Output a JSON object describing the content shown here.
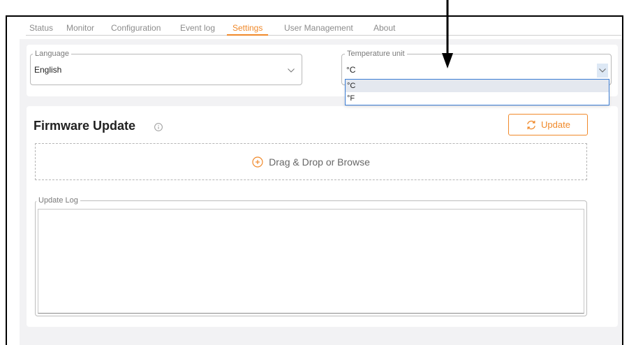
{
  "tabs": [
    {
      "label": "Status",
      "active": false
    },
    {
      "label": "Monitor",
      "active": false
    },
    {
      "label": "Configuration",
      "active": false
    },
    {
      "label": "Event log",
      "active": false
    },
    {
      "label": "Settings",
      "active": true
    },
    {
      "label": "User Management",
      "active": false
    },
    {
      "label": "About",
      "active": false
    }
  ],
  "settings": {
    "language": {
      "legend": "Language",
      "value": "English"
    },
    "temperature_unit": {
      "legend": "Temperature unit",
      "value": "°C",
      "dropdown_open": true,
      "options": [
        {
          "label": "°C",
          "selected": true
        },
        {
          "label": "°F",
          "selected": false
        }
      ]
    }
  },
  "firmware_update": {
    "title": "Firmware Update",
    "update_button": "Update",
    "drop_zone": "Drag & Drop or Browse",
    "log_legend": "Update Log",
    "log_text": ""
  },
  "icons": {
    "select_chevron": "chevron-down-icon",
    "info": "info-icon",
    "update": "refresh-icon",
    "drop_zone": "plus-circle-icon",
    "annotation": "arrow-down-icon"
  },
  "colors": {
    "accent": "#f0892a",
    "dropdown_border": "#3d7fd6",
    "selected_option_bg": "#e4e8ef",
    "panel_background": "#f2f2f4"
  }
}
